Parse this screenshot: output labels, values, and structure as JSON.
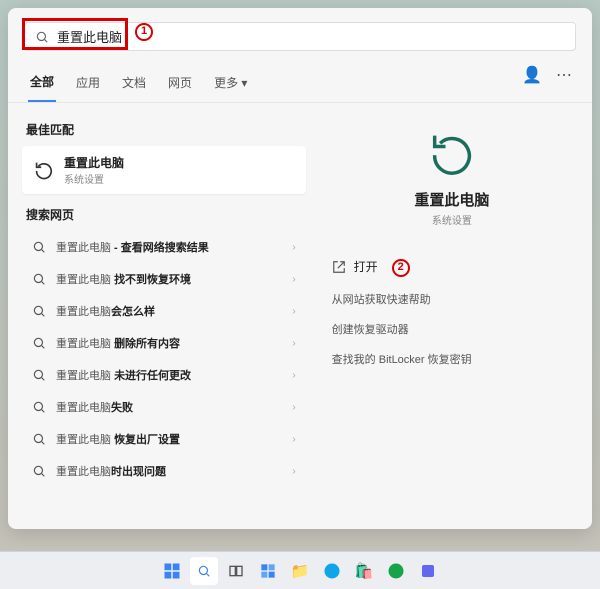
{
  "search": {
    "value": "重置此电脑"
  },
  "annotations": {
    "one": "1",
    "two": "2"
  },
  "tabs": {
    "all": "全部",
    "apps": "应用",
    "docs": "文档",
    "web": "网页",
    "more": "更多"
  },
  "left": {
    "best_heading": "最佳匹配",
    "best_title": "重置此电脑",
    "best_sub": "系统设置",
    "web_heading": "搜索网页",
    "items": [
      {
        "prefix": "重置此电脑",
        "suffix": " - 查看网络搜索结果"
      },
      {
        "prefix": "重置此电脑 ",
        "suffix": "找不到恢复环境"
      },
      {
        "prefix": "重置此电脑",
        "suffix": "会怎么样"
      },
      {
        "prefix": "重置此电脑 ",
        "suffix": "删除所有内容"
      },
      {
        "prefix": "重置此电脑 ",
        "suffix": "未进行任何更改"
      },
      {
        "prefix": "重置此电脑",
        "suffix": "失败"
      },
      {
        "prefix": "重置此电脑 ",
        "suffix": "恢复出厂设置"
      },
      {
        "prefix": "重置此电脑",
        "suffix": "时出现问题"
      }
    ]
  },
  "right": {
    "title": "重置此电脑",
    "sub": "系统设置",
    "open": "打开",
    "links": [
      "从网站获取快速帮助",
      "创建恢复驱动器",
      "查找我的 BitLocker 恢复密钥"
    ]
  }
}
